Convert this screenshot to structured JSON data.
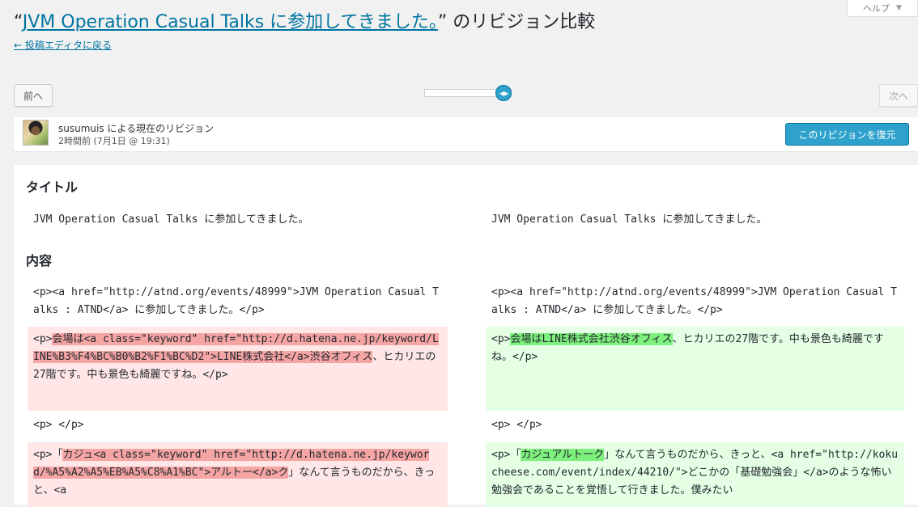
{
  "help_tab": {
    "label": "ヘルプ",
    "arrow": "▼"
  },
  "header": {
    "title_open_quote": "“",
    "title_link": "JVM Operation Casual Talks に参加してきました。",
    "title_suffix": "” のリビジョン比較",
    "back_link": "← 投稿エディタに戻る"
  },
  "nav": {
    "prev_label": "前へ",
    "next_label": "次へ",
    "slider_handle_glyph": "◀▶",
    "slider_level": 1.0
  },
  "revision_meta": {
    "author": "susumuis",
    "author_suffix": " による現在のリビジョン",
    "date": "2時間前 (7月1日 @ 19:31)",
    "restore_button": "このリビジョンを復元"
  },
  "diff": {
    "title_heading": "タイトル",
    "title_left": "JVM Operation Casual Talks に参加してきました。",
    "title_right": "JVM Operation Casual Talks に参加してきました。",
    "content_heading": "内容",
    "row1_left": "<p><a href=\"http://atnd.org/events/48999\">JVM Operation Casual Talks : ATND</a> に参加してきました。</p>",
    "row1_right": "<p><a href=\"http://atnd.org/events/48999\">JVM Operation Casual Talks : ATND</a> に参加してきました。</p>",
    "row2_left": {
      "pre": "<p>",
      "changed": "会場は<a class=\"keyword\" href=\"http://d.hatena.ne.jp/keyword/LINE%B3%F4%BC%B0%B2%F1%BC%D2\">LINE株式会社</a>渋谷オフィス",
      "post": "、ヒカリエの27階です。中も景色も綺麗ですね。</p>"
    },
    "row2_right": {
      "pre": "<p>",
      "changed": "会場はLINE株式会社渋谷オフィス",
      "post": "、ヒカリエの27階です。中も景色も綺麗ですね。</p>"
    },
    "row3_left": "<p> </p>",
    "row3_right": "<p> </p>",
    "row4_left": {
      "pre": "<p>「",
      "changed": "カジュ<a class=\"keyword\" href=\"http://d.hatena.ne.jp/keyword/%A5%A2%A5%EB%A5%C8%A1%BC\">アルトー</a>ク",
      "post": "」なんて言うものだから、きっと、<a"
    },
    "row4_right": {
      "pre": "<p>「",
      "changed": "カジュアルトーク",
      "post": "」なんて言うものだから、きっと、<a href=\"http://kokucheese.com/event/index/44210/\">どこかの「基礎勉強会」</a>のような怖い勉強会であることを覚悟して行きました。僕みたい"
    }
  }
}
